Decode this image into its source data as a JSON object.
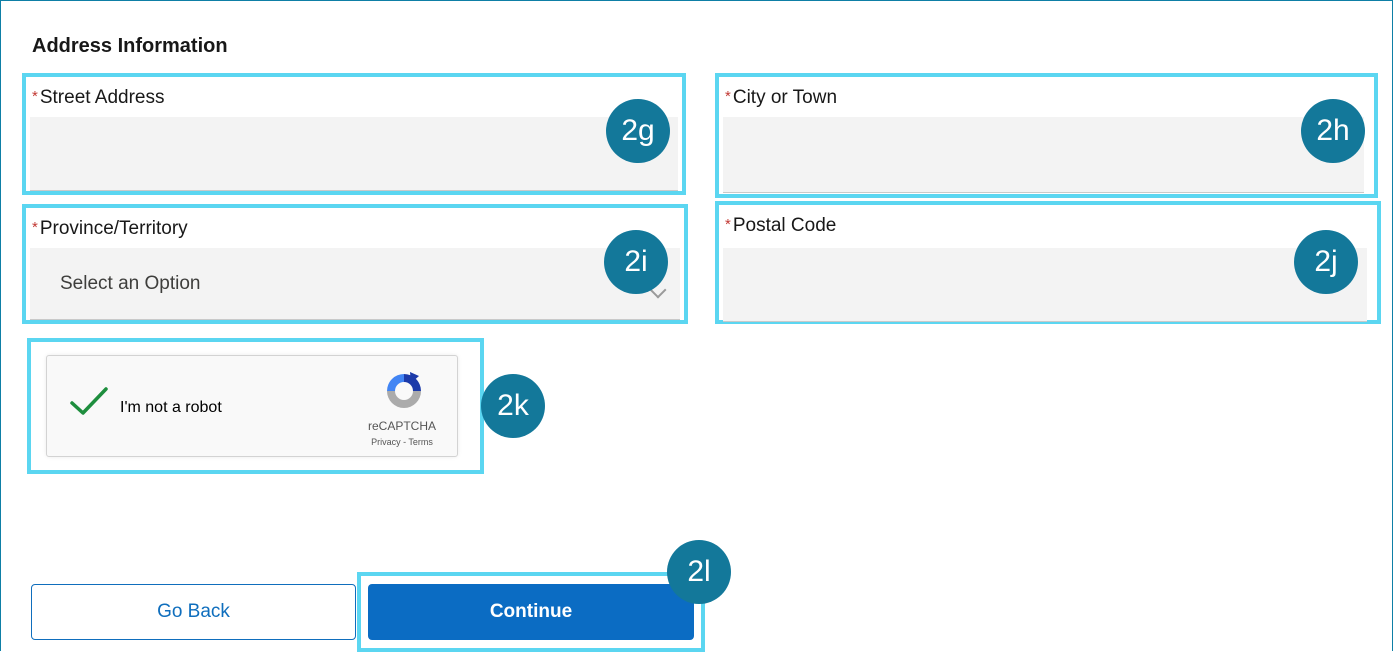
{
  "section": {
    "title": "Address Information"
  },
  "required_marker": "*",
  "fields": {
    "street": {
      "label": "Street Address",
      "value": "",
      "badge": "2g"
    },
    "city": {
      "label": "City or Town",
      "value": "",
      "badge": "2h"
    },
    "province": {
      "label": "Province/Territory",
      "selected": "Select an Option",
      "badge": "2i"
    },
    "postal": {
      "label": "Postal Code",
      "value": "",
      "badge": "2j"
    }
  },
  "captcha": {
    "text": "I'm not a robot",
    "brand": "reCAPTCHA",
    "links": "Privacy - Terms",
    "checked": true,
    "badge": "2k"
  },
  "buttons": {
    "back_label": "Go Back",
    "continue_label": "Continue",
    "continue_badge": "2l"
  },
  "colors": {
    "highlight": "#5bd6f1",
    "badge": "#13789a",
    "primary": "#0b6cc3",
    "required": "#c23934",
    "check": "#1e8e3e"
  }
}
